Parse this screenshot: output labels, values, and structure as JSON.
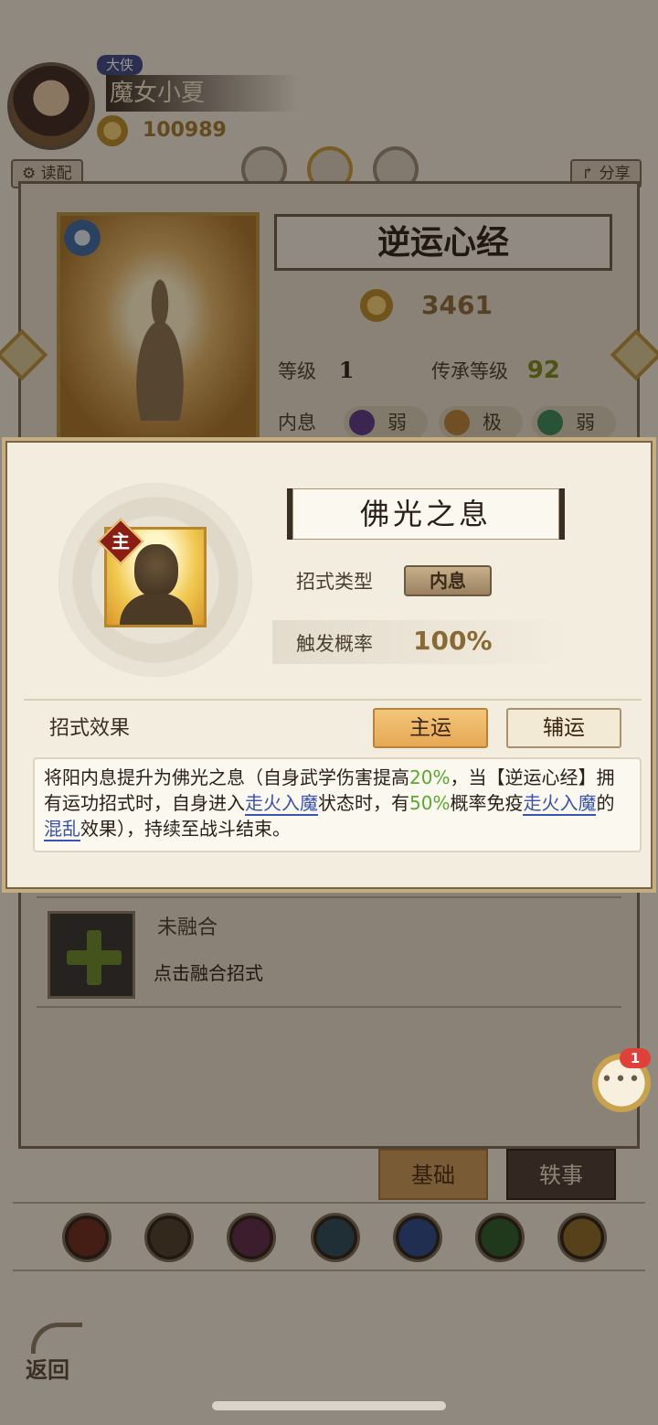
{
  "player": {
    "rank": "大侠",
    "name": "魔女小夏",
    "coins": "100989"
  },
  "top_buttons": {
    "left": "读配",
    "right": "分享"
  },
  "technique": {
    "name": "逆运心经",
    "power": "3461",
    "level_label": "等级",
    "level_value": "1",
    "inherit_label": "传承等级",
    "inherit_value": "92",
    "breath_label": "内息",
    "breaths": [
      {
        "label": "弱",
        "color": "#5a3a8a"
      },
      {
        "label": "极",
        "color": "#b8823a"
      },
      {
        "label": "弱",
        "color": "#3a8a5a"
      }
    ]
  },
  "fusion": {
    "title": "未融合",
    "hint": "点击融合招式"
  },
  "bottom_tabs": {
    "basic": "基础",
    "lore": "轶事"
  },
  "schools": [
    {
      "name": "sword-school-icon",
      "color": "#6a2a1e"
    },
    {
      "name": "blade-school-icon",
      "color": "#4a3e2a"
    },
    {
      "name": "fist-school-icon",
      "color": "#5a2a4a"
    },
    {
      "name": "fan-school-icon",
      "color": "#2a4a5a"
    },
    {
      "name": "taiji-school-icon",
      "color": "#2a4a8a"
    },
    {
      "name": "poison-school-icon",
      "color": "#2a5a2a"
    },
    {
      "name": "all-school-icon",
      "color": "#8a6a2a"
    }
  ],
  "back_label": "返回",
  "chat": {
    "badge": "1"
  },
  "popup": {
    "skill_name": "佛光之息",
    "main_badge": "主",
    "type_label": "招式类型",
    "type_value": "内息",
    "chance_label": "触发概率",
    "chance_value": "100%",
    "effect_label": "招式效果",
    "btn_main": "主运",
    "btn_aux": "辅运",
    "effect": {
      "t1": "将阳内息提升为佛光之息（自身武学伤害提高",
      "v1": "20%",
      "t2": "，当【逆运心经】拥有运功招式时，自身进入",
      "link1": "走火入魔",
      "t3": "状态时，有",
      "v2": "50%",
      "t4": "概率免疫",
      "link2": "走火入魔",
      "t5": "的",
      "link3": "混乱",
      "t6": "效果），持续至战斗结束。"
    }
  }
}
